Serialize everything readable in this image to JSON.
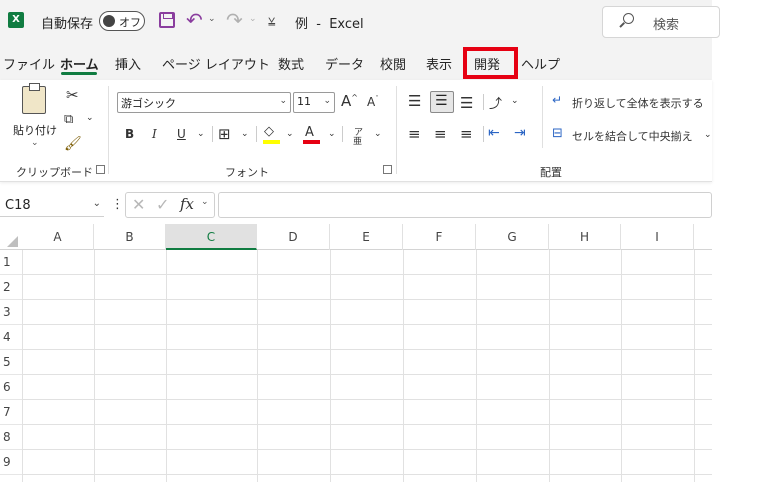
{
  "titlebar": {
    "app_icon": "excel-logo-icon",
    "app_icon_letter": "X",
    "autosave_label": "自動保存",
    "autosave_state": "オフ",
    "save_icon": "save-icon",
    "undo_icon": "undo-icon",
    "redo_icon": "redo-icon",
    "qat_more": "⩣",
    "document_title": "例  -  Excel",
    "search_placeholder": "検索"
  },
  "tabs": [
    {
      "label": "ファイル"
    },
    {
      "label": "ホーム",
      "active": true
    },
    {
      "label": "挿入"
    },
    {
      "label": "ページ レイアウト"
    },
    {
      "label": "数式"
    },
    {
      "label": "データ"
    },
    {
      "label": "校閲"
    },
    {
      "label": "表示"
    },
    {
      "label": "開発",
      "highlighted": true
    },
    {
      "label": "ヘルプ"
    }
  ],
  "ribbon": {
    "clipboard": {
      "paste_label": "貼り付け",
      "group_label": "クリップボード"
    },
    "font": {
      "font_name": "游ゴシック",
      "font_size": "11",
      "bold": "B",
      "italic": "I",
      "underline": "U",
      "font_color_letter": "A",
      "phonetic": "ア",
      "grow": "A",
      "shrink": "A",
      "group_label": "フォント",
      "highlight_color": "#ffff00",
      "font_color": "#e60012"
    },
    "alignment": {
      "wrap_text": "折り返して全体を表示する",
      "merge_center": "セルを結合して中央揃え",
      "group_label": "配置"
    }
  },
  "formula_bar": {
    "name_box": "C18",
    "fx_label": "fx",
    "formula": ""
  },
  "grid": {
    "columns": [
      "A",
      "B",
      "C",
      "D",
      "E",
      "F",
      "G",
      "H",
      "I"
    ],
    "selected_column": "C",
    "rows": [
      "1",
      "2",
      "3",
      "4",
      "5",
      "6",
      "7",
      "8",
      "9"
    ]
  },
  "colors": {
    "accent": "#107c41",
    "highlight_box": "#e60012",
    "qat_icon": "#8a3d9e"
  }
}
